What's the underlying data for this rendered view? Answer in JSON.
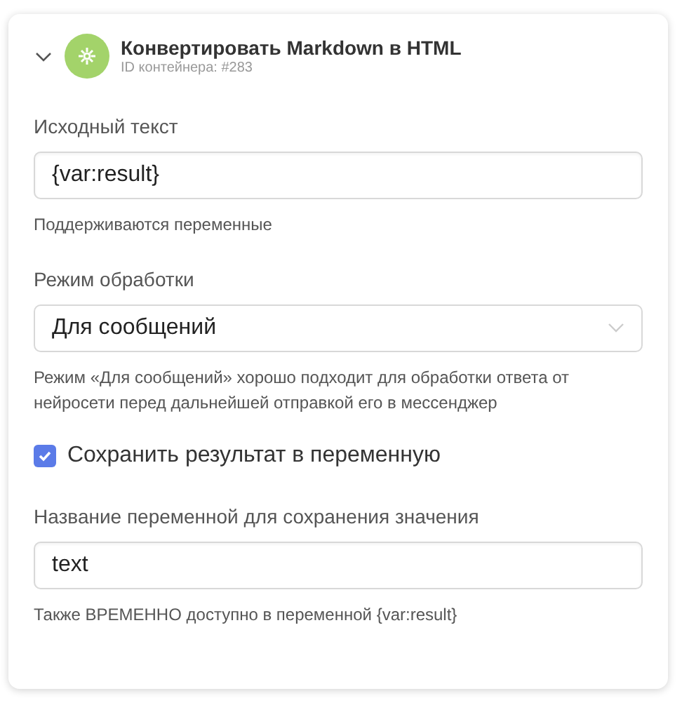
{
  "block": {
    "title": "Конвертировать Markdown в HTML",
    "subtitle": "ID контейнера: #283",
    "expanded": true
  },
  "fields": [
    {
      "kind": "text",
      "label": "Исходный текст",
      "value": "{var:result}",
      "hint": "Поддерживаются переменные"
    },
    {
      "kind": "select",
      "label": "Режим обработки",
      "value": "Для сообщений",
      "hint": "Режим «Для сообщений» хорошо подходит для обработки ответа от нейросети перед дальнейшей отправкой его в мессенджер"
    },
    {
      "kind": "checkbox",
      "label": "Сохранить результат в переменную",
      "checked": true
    },
    {
      "kind": "text",
      "label": "Название переменной для сохранения значения",
      "value": "text",
      "hint": "Также ВРЕМЕННО доступно в переменной {var:result}"
    }
  ]
}
